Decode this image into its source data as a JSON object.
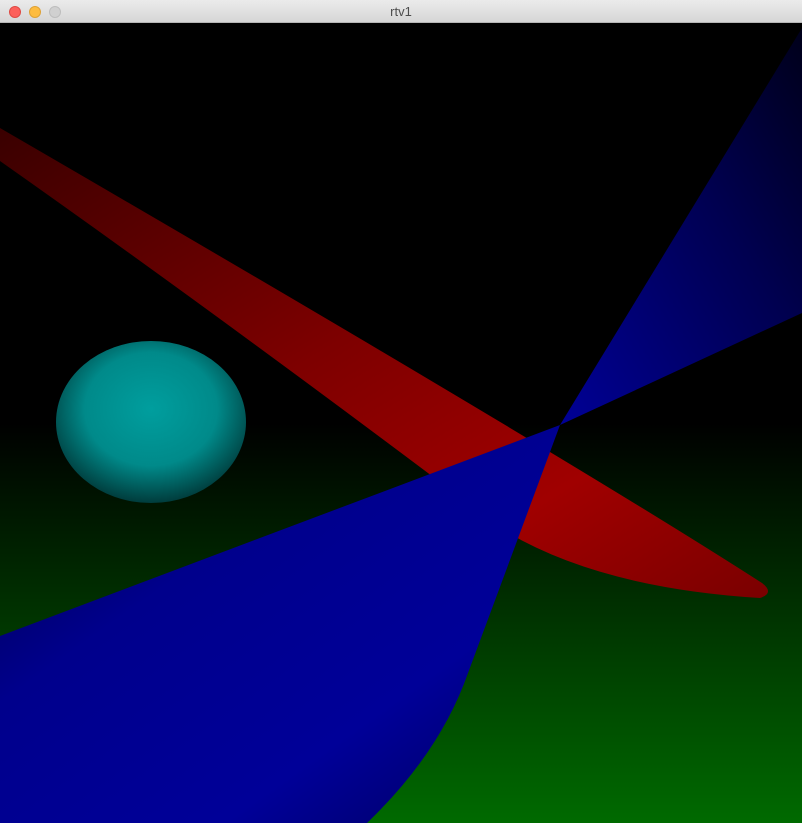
{
  "window": {
    "title": "rtv1",
    "controls": [
      "close-icon",
      "minimize-icon",
      "zoom-icon"
    ]
  },
  "scene": {
    "background_color": "#000000",
    "objects": [
      {
        "name": "plane",
        "color": "#008000"
      },
      {
        "name": "sphere",
        "color": "#009a9a"
      },
      {
        "name": "cylinder",
        "color": "#8a0000"
      },
      {
        "name": "cone",
        "color": "#00008c"
      }
    ]
  }
}
